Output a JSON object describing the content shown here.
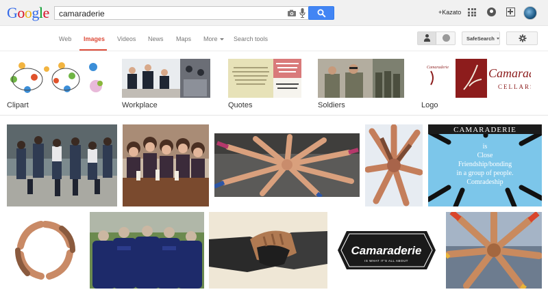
{
  "logo": {
    "letters": [
      "G",
      "o",
      "o",
      "g",
      "l",
      "e"
    ]
  },
  "search": {
    "query": "camaraderie"
  },
  "header": {
    "user": "+Kazato"
  },
  "nav": {
    "web": "Web",
    "images": "Images",
    "videos": "Videos",
    "news": "News",
    "maps": "Maps",
    "more": "More",
    "search_tools": "Search tools"
  },
  "toolbar": {
    "safesearch": "SafeSearch"
  },
  "related": [
    {
      "label": "Clipart"
    },
    {
      "label": "Workplace"
    },
    {
      "label": "Quotes"
    },
    {
      "label": "Soldiers"
    },
    {
      "label": "Logo"
    }
  ],
  "image_texts": {
    "logo_small": "Camaraderie",
    "cellars_title": "Camaraderie",
    "cellars_sub": "CELLARS",
    "definition_title": "CAMARADERIE",
    "definition_lines": [
      "is",
      "Close",
      "Friendship/bonding",
      "in a group of people.",
      "Comradeship"
    ],
    "badge_title": "Camaraderie",
    "badge_sub": "IS WHAT IT'S ALL ABOUT"
  },
  "colors": {
    "brand_blue": "#4285f4",
    "active_red": "#dd4b39",
    "topbar": "#f1f1f1"
  }
}
